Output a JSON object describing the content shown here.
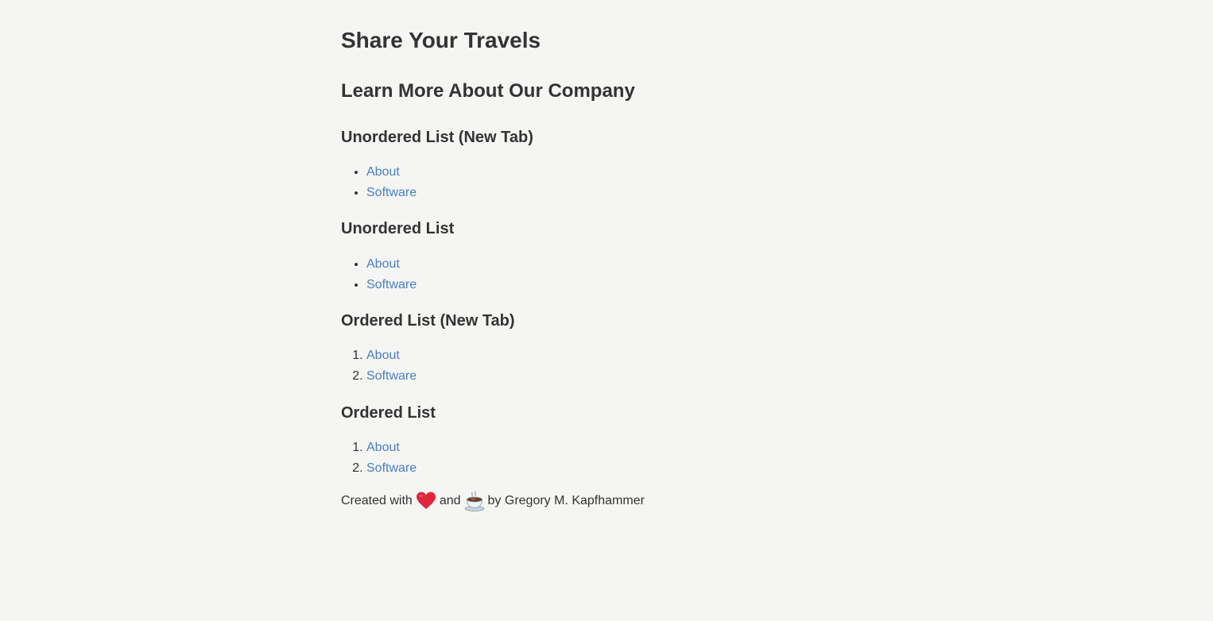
{
  "page": {
    "title": "Share Your Travels",
    "subtitle": "Learn More About Our Company"
  },
  "sections": [
    {
      "heading": "Unordered List (New Tab)",
      "items": [
        "About",
        "Software"
      ]
    },
    {
      "heading": "Unordered List",
      "items": [
        "About",
        "Software"
      ]
    },
    {
      "heading": "Ordered List (New Tab)",
      "items": [
        "About",
        "Software"
      ]
    },
    {
      "heading": "Ordered List",
      "items": [
        "About",
        "Software"
      ]
    }
  ],
  "footer": {
    "prefix": "Created with",
    "heart_icon": "heart-icon",
    "connector": "and",
    "coffee_icon": "coffee-icon",
    "suffix": "by Gregory M. Kapfhammer"
  },
  "colors": {
    "background": "#f5f5f3",
    "text": "#333333",
    "link": "#4a7fbf",
    "heart": "#e0263c"
  }
}
